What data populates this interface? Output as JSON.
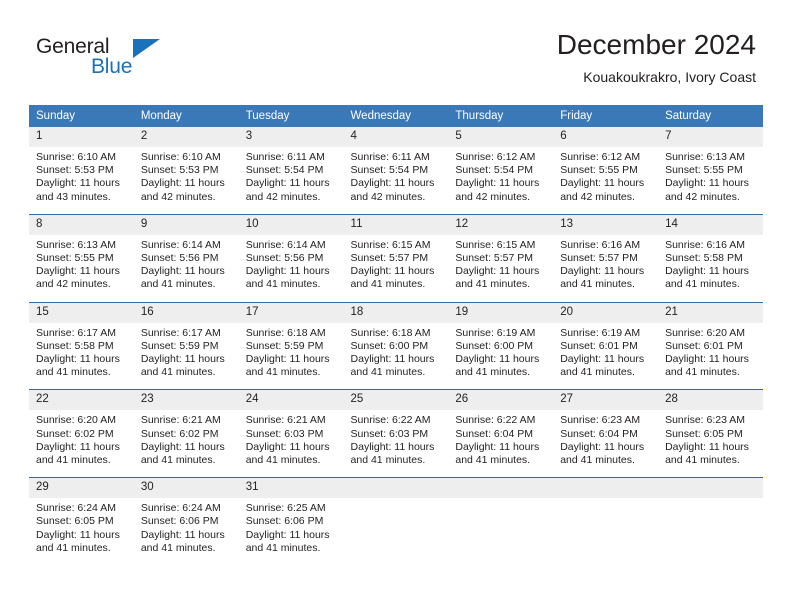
{
  "brand": {
    "name_primary": "General",
    "name_secondary": "Blue",
    "color_primary": "#231f20",
    "color_secondary": "#1a72bb"
  },
  "header": {
    "title": "December 2024",
    "subtitle": "Kouakoukrakro, Ivory Coast",
    "accent_color": "#3b78b8",
    "separator_color": "#2e6da4",
    "daynum_background": "#eeeeee"
  },
  "weekday_headers": [
    "Sunday",
    "Monday",
    "Tuesday",
    "Wednesday",
    "Thursday",
    "Friday",
    "Saturday"
  ],
  "weeks": [
    [
      {
        "day": "1",
        "sunrise": "Sunrise: 6:10 AM",
        "sunset": "Sunset: 5:53 PM",
        "daylight_1": "Daylight: 11 hours",
        "daylight_2": "and 43 minutes."
      },
      {
        "day": "2",
        "sunrise": "Sunrise: 6:10 AM",
        "sunset": "Sunset: 5:53 PM",
        "daylight_1": "Daylight: 11 hours",
        "daylight_2": "and 42 minutes."
      },
      {
        "day": "3",
        "sunrise": "Sunrise: 6:11 AM",
        "sunset": "Sunset: 5:54 PM",
        "daylight_1": "Daylight: 11 hours",
        "daylight_2": "and 42 minutes."
      },
      {
        "day": "4",
        "sunrise": "Sunrise: 6:11 AM",
        "sunset": "Sunset: 5:54 PM",
        "daylight_1": "Daylight: 11 hours",
        "daylight_2": "and 42 minutes."
      },
      {
        "day": "5",
        "sunrise": "Sunrise: 6:12 AM",
        "sunset": "Sunset: 5:54 PM",
        "daylight_1": "Daylight: 11 hours",
        "daylight_2": "and 42 minutes."
      },
      {
        "day": "6",
        "sunrise": "Sunrise: 6:12 AM",
        "sunset": "Sunset: 5:55 PM",
        "daylight_1": "Daylight: 11 hours",
        "daylight_2": "and 42 minutes."
      },
      {
        "day": "7",
        "sunrise": "Sunrise: 6:13 AM",
        "sunset": "Sunset: 5:55 PM",
        "daylight_1": "Daylight: 11 hours",
        "daylight_2": "and 42 minutes."
      }
    ],
    [
      {
        "day": "8",
        "sunrise": "Sunrise: 6:13 AM",
        "sunset": "Sunset: 5:55 PM",
        "daylight_1": "Daylight: 11 hours",
        "daylight_2": "and 42 minutes."
      },
      {
        "day": "9",
        "sunrise": "Sunrise: 6:14 AM",
        "sunset": "Sunset: 5:56 PM",
        "daylight_1": "Daylight: 11 hours",
        "daylight_2": "and 41 minutes."
      },
      {
        "day": "10",
        "sunrise": "Sunrise: 6:14 AM",
        "sunset": "Sunset: 5:56 PM",
        "daylight_1": "Daylight: 11 hours",
        "daylight_2": "and 41 minutes."
      },
      {
        "day": "11",
        "sunrise": "Sunrise: 6:15 AM",
        "sunset": "Sunset: 5:57 PM",
        "daylight_1": "Daylight: 11 hours",
        "daylight_2": "and 41 minutes."
      },
      {
        "day": "12",
        "sunrise": "Sunrise: 6:15 AM",
        "sunset": "Sunset: 5:57 PM",
        "daylight_1": "Daylight: 11 hours",
        "daylight_2": "and 41 minutes."
      },
      {
        "day": "13",
        "sunrise": "Sunrise: 6:16 AM",
        "sunset": "Sunset: 5:57 PM",
        "daylight_1": "Daylight: 11 hours",
        "daylight_2": "and 41 minutes."
      },
      {
        "day": "14",
        "sunrise": "Sunrise: 6:16 AM",
        "sunset": "Sunset: 5:58 PM",
        "daylight_1": "Daylight: 11 hours",
        "daylight_2": "and 41 minutes."
      }
    ],
    [
      {
        "day": "15",
        "sunrise": "Sunrise: 6:17 AM",
        "sunset": "Sunset: 5:58 PM",
        "daylight_1": "Daylight: 11 hours",
        "daylight_2": "and 41 minutes."
      },
      {
        "day": "16",
        "sunrise": "Sunrise: 6:17 AM",
        "sunset": "Sunset: 5:59 PM",
        "daylight_1": "Daylight: 11 hours",
        "daylight_2": "and 41 minutes."
      },
      {
        "day": "17",
        "sunrise": "Sunrise: 6:18 AM",
        "sunset": "Sunset: 5:59 PM",
        "daylight_1": "Daylight: 11 hours",
        "daylight_2": "and 41 minutes."
      },
      {
        "day": "18",
        "sunrise": "Sunrise: 6:18 AM",
        "sunset": "Sunset: 6:00 PM",
        "daylight_1": "Daylight: 11 hours",
        "daylight_2": "and 41 minutes."
      },
      {
        "day": "19",
        "sunrise": "Sunrise: 6:19 AM",
        "sunset": "Sunset: 6:00 PM",
        "daylight_1": "Daylight: 11 hours",
        "daylight_2": "and 41 minutes."
      },
      {
        "day": "20",
        "sunrise": "Sunrise: 6:19 AM",
        "sunset": "Sunset: 6:01 PM",
        "daylight_1": "Daylight: 11 hours",
        "daylight_2": "and 41 minutes."
      },
      {
        "day": "21",
        "sunrise": "Sunrise: 6:20 AM",
        "sunset": "Sunset: 6:01 PM",
        "daylight_1": "Daylight: 11 hours",
        "daylight_2": "and 41 minutes."
      }
    ],
    [
      {
        "day": "22",
        "sunrise": "Sunrise: 6:20 AM",
        "sunset": "Sunset: 6:02 PM",
        "daylight_1": "Daylight: 11 hours",
        "daylight_2": "and 41 minutes."
      },
      {
        "day": "23",
        "sunrise": "Sunrise: 6:21 AM",
        "sunset": "Sunset: 6:02 PM",
        "daylight_1": "Daylight: 11 hours",
        "daylight_2": "and 41 minutes."
      },
      {
        "day": "24",
        "sunrise": "Sunrise: 6:21 AM",
        "sunset": "Sunset: 6:03 PM",
        "daylight_1": "Daylight: 11 hours",
        "daylight_2": "and 41 minutes."
      },
      {
        "day": "25",
        "sunrise": "Sunrise: 6:22 AM",
        "sunset": "Sunset: 6:03 PM",
        "daylight_1": "Daylight: 11 hours",
        "daylight_2": "and 41 minutes."
      },
      {
        "day": "26",
        "sunrise": "Sunrise: 6:22 AM",
        "sunset": "Sunset: 6:04 PM",
        "daylight_1": "Daylight: 11 hours",
        "daylight_2": "and 41 minutes."
      },
      {
        "day": "27",
        "sunrise": "Sunrise: 6:23 AM",
        "sunset": "Sunset: 6:04 PM",
        "daylight_1": "Daylight: 11 hours",
        "daylight_2": "and 41 minutes."
      },
      {
        "day": "28",
        "sunrise": "Sunrise: 6:23 AM",
        "sunset": "Sunset: 6:05 PM",
        "daylight_1": "Daylight: 11 hours",
        "daylight_2": "and 41 minutes."
      }
    ],
    [
      {
        "day": "29",
        "sunrise": "Sunrise: 6:24 AM",
        "sunset": "Sunset: 6:05 PM",
        "daylight_1": "Daylight: 11 hours",
        "daylight_2": "and 41 minutes."
      },
      {
        "day": "30",
        "sunrise": "Sunrise: 6:24 AM",
        "sunset": "Sunset: 6:06 PM",
        "daylight_1": "Daylight: 11 hours",
        "daylight_2": "and 41 minutes."
      },
      {
        "day": "31",
        "sunrise": "Sunrise: 6:25 AM",
        "sunset": "Sunset: 6:06 PM",
        "daylight_1": "Daylight: 11 hours",
        "daylight_2": "and 41 minutes."
      },
      {
        "day": "",
        "sunrise": "",
        "sunset": "",
        "daylight_1": "",
        "daylight_2": ""
      },
      {
        "day": "",
        "sunrise": "",
        "sunset": "",
        "daylight_1": "",
        "daylight_2": ""
      },
      {
        "day": "",
        "sunrise": "",
        "sunset": "",
        "daylight_1": "",
        "daylight_2": ""
      },
      {
        "day": "",
        "sunrise": "",
        "sunset": "",
        "daylight_1": "",
        "daylight_2": ""
      }
    ]
  ]
}
